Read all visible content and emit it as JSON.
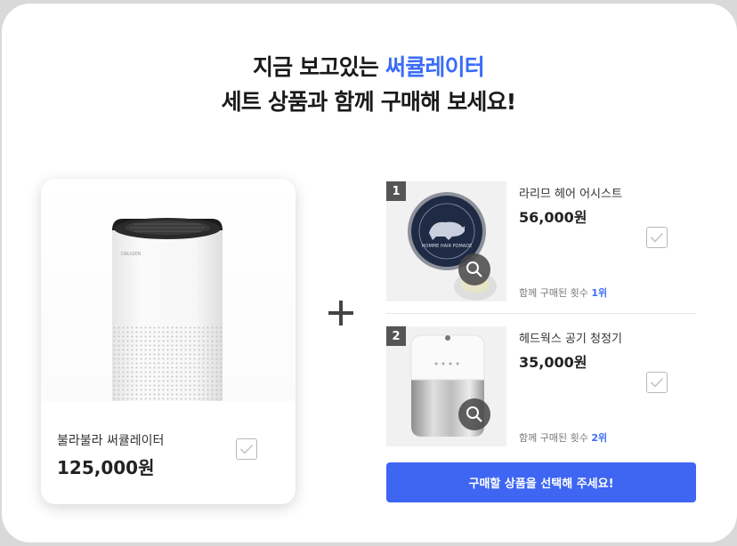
{
  "headline": {
    "line1_prefix": "지금 보고있는",
    "line1_accent": "써큘레이터",
    "line2": "세트 상품과 함께 구매해 보세요!"
  },
  "main_product": {
    "name": "불라불라 써큘레이터",
    "price": "125,000원",
    "brand_mark": "DALIGEN",
    "image": "air-purifier-image"
  },
  "plus_icon": "plus-icon",
  "set_items": [
    {
      "rank": "1",
      "name": "라리므 헤어 어시스트",
      "price": "56,000원",
      "rank_text_prefix": "함께 구매된 횟수",
      "rank_text_value": "1위",
      "image": "hair-pomade-image",
      "lid_text": "HOMME HAIR POMADE"
    },
    {
      "rank": "2",
      "name": "헤드웍스 공기 청정기",
      "price": "35,000원",
      "rank_text_prefix": "함께 구매된 횟수",
      "rank_text_value": "2위",
      "image": "mini-air-purifier-image"
    }
  ],
  "buy_button": {
    "label": "구매할 상품을 선택해 주세요!"
  },
  "colors": {
    "accent": "#3b6cf6",
    "button": "#3e66f2",
    "rank_badge": "#555555"
  }
}
